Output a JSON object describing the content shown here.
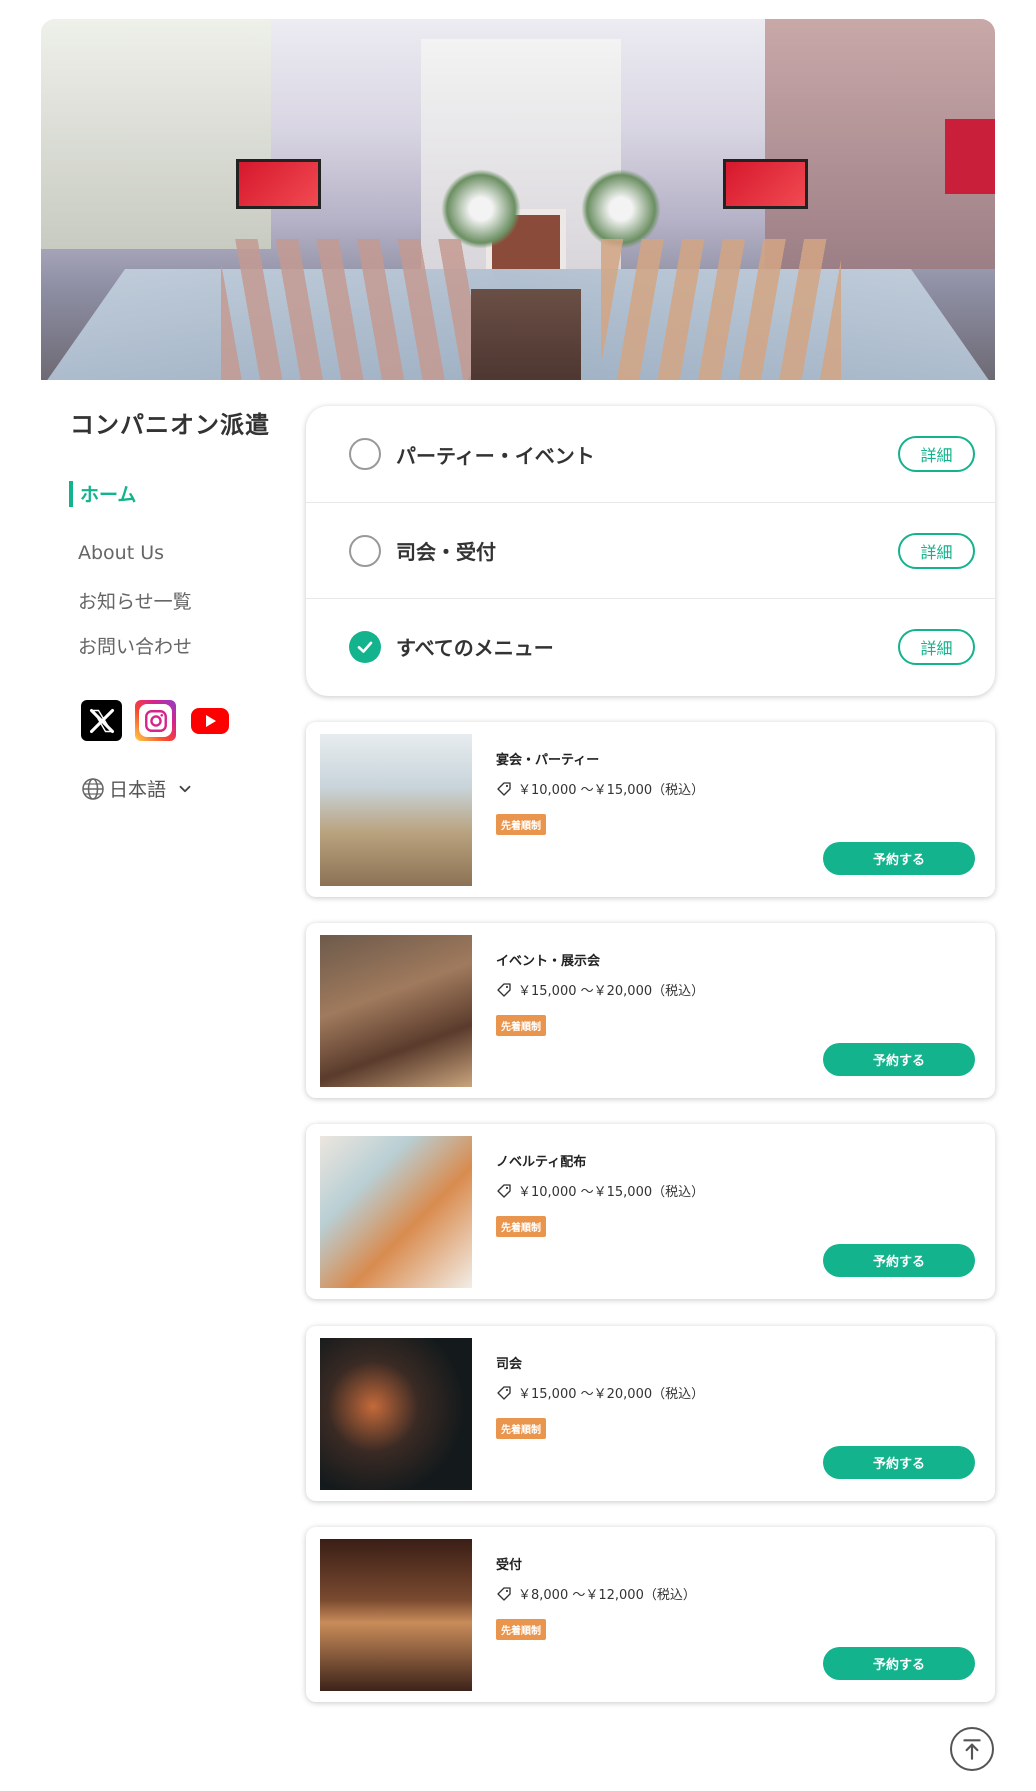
{
  "sidebar": {
    "brand": "コンパニオン派遣",
    "nav_active": "ホーム",
    "nav_links": [
      "About Us",
      "お知らせ一覧",
      "お問い合わせ"
    ],
    "language": "日本語"
  },
  "filters": [
    {
      "label": "パーティー・イベント",
      "checked": false,
      "detail": "詳細"
    },
    {
      "label": "司会・受付",
      "checked": false,
      "detail": "詳細"
    },
    {
      "label": "すべてのメニュー",
      "checked": true,
      "detail": "詳細"
    }
  ],
  "menu_items": [
    {
      "title": "宴会・パーティー",
      "price": "￥10,000 ～￥15,000（税込）",
      "tag": "先着順制",
      "button": "予約する"
    },
    {
      "title": "イベント・展示会",
      "price": "￥15,000 ～￥20,000（税込）",
      "tag": "先着順制",
      "button": "予約する"
    },
    {
      "title": "ノベルティ配布",
      "price": "￥10,000 ～￥15,000（税込）",
      "tag": "先着順制",
      "button": "予約する"
    },
    {
      "title": "司会",
      "price": "￥15,000 ～￥20,000（税込）",
      "tag": "先着順制",
      "button": "予約する"
    },
    {
      "title": "受付",
      "price": "￥8,000 ～￥12,000（税込）",
      "tag": "先着順制",
      "button": "予約する"
    }
  ],
  "colors": {
    "accent": "#13b38d",
    "tag": "#e9954e"
  }
}
